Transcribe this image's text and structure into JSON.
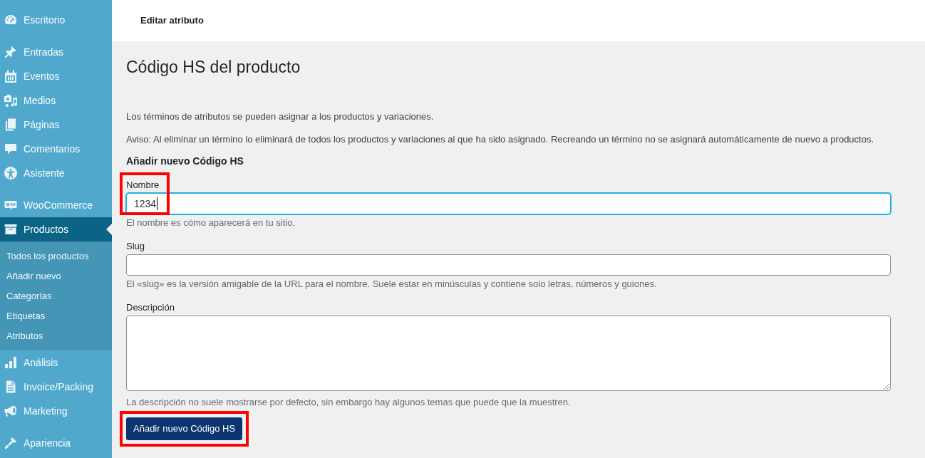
{
  "sidebar": {
    "groups": [
      {
        "items": [
          {
            "label": "Escritorio",
            "selected": false
          }
        ]
      },
      {
        "items": [
          {
            "label": "Entradas",
            "selected": false
          },
          {
            "label": "Eventos",
            "selected": false
          },
          {
            "label": "Medios",
            "selected": false
          },
          {
            "label": "Páginas",
            "selected": false
          },
          {
            "label": "Comentarios",
            "selected": false
          },
          {
            "label": "Asistente",
            "selected": false
          }
        ]
      },
      {
        "items": [
          {
            "label": "WooCommerce",
            "selected": false
          },
          {
            "label": "Productos",
            "selected": true,
            "children": [
              {
                "label": "Todos los productos",
                "selected": false
              },
              {
                "label": "Añadir nuevo",
                "selected": false
              },
              {
                "label": "Categorías",
                "selected": false
              },
              {
                "label": "Etiquetas",
                "selected": false
              },
              {
                "label": "Atributos",
                "selected": false
              }
            ]
          },
          {
            "label": "Análisis",
            "selected": false
          },
          {
            "label": "Invoice/Packing",
            "selected": false
          },
          {
            "label": "Marketing",
            "selected": false
          }
        ]
      },
      {
        "items": [
          {
            "label": "Apariencia",
            "selected": false
          }
        ]
      }
    ]
  },
  "header": {
    "title": "Editar atributo"
  },
  "page": {
    "heading": "Código HS del producto",
    "paragraphs": [
      "Los términos de atributos se pueden asignar a los productos y variaciones.",
      "Aviso: Al eliminar un término lo eliminará de todos los productos y variaciones al que ha sido asignado. Recreando un término no se asignará automáticamente de nuevo a productos."
    ],
    "form": {
      "title": "Añadir nuevo Código HS",
      "fields": [
        {
          "kind": "text",
          "label": "Nombre",
          "value": "1234",
          "focused": true,
          "highlighted": true,
          "help": "El nombre es cómo aparecerá en tu sitio."
        },
        {
          "kind": "text",
          "label": "Slug",
          "focused": false,
          "highlighted": false,
          "help": "El «slug» es la versión amigable de la URL para el nombre. Suele estar en minúsculas y contiene solo letras, números y guiones."
        },
        {
          "kind": "textarea",
          "label": "Descripción",
          "focused": false,
          "highlighted": false,
          "help": "La descripción no suele mostrarse por defecto, sin embargo hay algunos temas que puede que la muestren."
        }
      ],
      "submit": {
        "label": "Añadir nuevo Código HS",
        "highlighted": true
      }
    }
  }
}
